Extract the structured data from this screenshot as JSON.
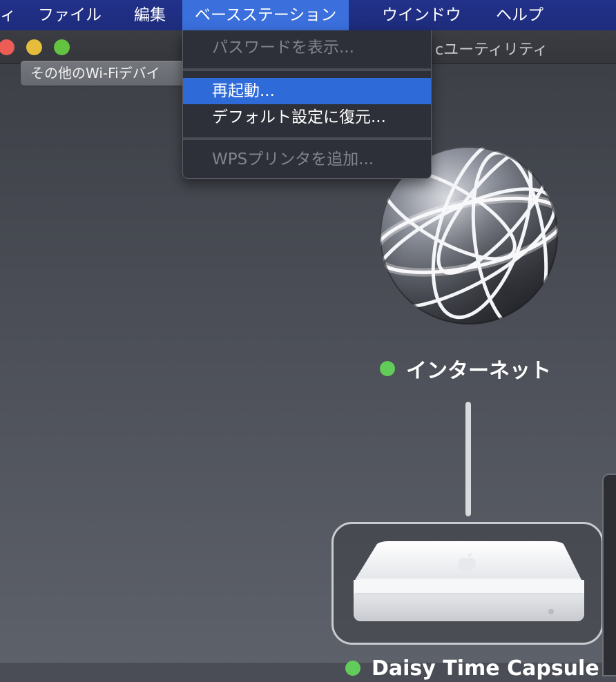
{
  "menubar": {
    "partial_app": "ィ",
    "items": [
      "ファイル",
      "編集",
      "ベースステーション",
      "ウインドウ",
      "ヘルプ"
    ]
  },
  "window": {
    "title_partial": "cユーティリティ",
    "other_devices_button": "その他のWi-Fiデバイ"
  },
  "menu": {
    "items": [
      {
        "label": "パスワードを表示...",
        "enabled": false
      },
      {
        "label": "再起動...",
        "enabled": true,
        "highlighted": true
      },
      {
        "label": "デフォルト設定に復元...",
        "enabled": true
      },
      {
        "label": "WPSプリンタを追加...",
        "enabled": false
      }
    ]
  },
  "diagram": {
    "internet_label": "インターネット",
    "internet_status_color": "#62cc5a",
    "device_label_partial": "Daisy Time Capsule",
    "device_status_color": "#62cc5a"
  },
  "icons": {
    "globe": "network-globe-icon",
    "device": "airport-base-station-icon",
    "apple": "apple-logo-icon"
  },
  "colors": {
    "menubar": "#22318a",
    "menu_highlight": "#2f6ad9",
    "close": "#ee5c56",
    "minimize": "#e6bd3b",
    "maximize": "#63c23f"
  }
}
